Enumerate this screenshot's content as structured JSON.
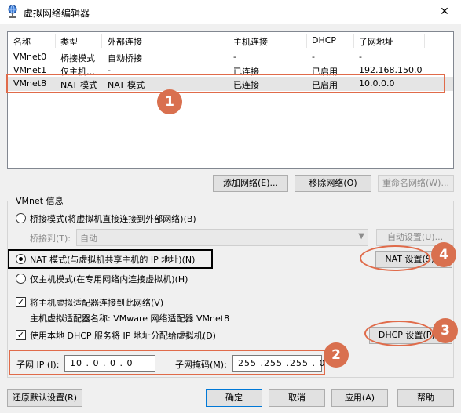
{
  "window": {
    "title": "虚拟网络编辑器",
    "close": "✕"
  },
  "list": {
    "headers": [
      "名称",
      "类型",
      "外部连接",
      "主机连接",
      "DHCP",
      "子网地址"
    ],
    "rows": [
      [
        "VMnet0",
        "桥接模式",
        "自动桥接",
        "-",
        "-",
        "-"
      ],
      [
        "VMnet1",
        "仅主机…",
        "-",
        "已连接",
        "已启用",
        "192.168.150.0"
      ],
      [
        "VMnet8",
        "NAT 模式",
        "NAT 模式",
        "已连接",
        "已启用",
        "10.0.0.0"
      ]
    ],
    "selected_index": 2
  },
  "list_buttons": {
    "add": "添加网络(E)...",
    "remove": "移除网络(O)",
    "rename": "重命名网络(W)..."
  },
  "vmnet_info": {
    "group_title": "VMnet 信息",
    "bridge_label": "桥接模式(将虚拟机直接连接到外部网络)(B)",
    "bridged_to_label": "桥接到(T):",
    "bridged_to_value": "自动",
    "auto_settings": "自动设置(U)...",
    "nat_label": "NAT 模式(与虚拟机共享主机的 IP 地址)(N)",
    "nat_settings": "NAT 设置(S)...",
    "hostonly_label": "仅主机模式(在专用网络内连接虚拟机)(H)",
    "connect_adapter_label": "将主机虚拟适配器连接到此网络(V)",
    "adapter_name_label": "主机虚拟适配器名称: VMware 网络适配器 VMnet8",
    "use_dhcp_label": "使用本地 DHCP 服务将 IP 地址分配给虚拟机(D)",
    "dhcp_settings": "DHCP 设置(P)...",
    "subnet_ip_label": "子网 IP (I):",
    "subnet_ip_value": "10 . 0 . 0 . 0",
    "subnet_mask_label": "子网掩码(M):",
    "subnet_mask_value": "255 .255 .255 . 0",
    "selected_mode": "nat",
    "connect_adapter_checked": true,
    "use_dhcp_checked": true
  },
  "footer": {
    "restore": "还原默认设置(R)",
    "ok": "确定",
    "cancel": "取消",
    "apply": "应用(A)",
    "help": "帮助"
  },
  "annotations": {
    "badge1": "1",
    "badge2": "2",
    "badge3": "3",
    "badge4": "4"
  },
  "colors": {
    "annotation": "#e06b4a",
    "selection": "#e5e5e5",
    "focus_border": "#0078d7"
  }
}
